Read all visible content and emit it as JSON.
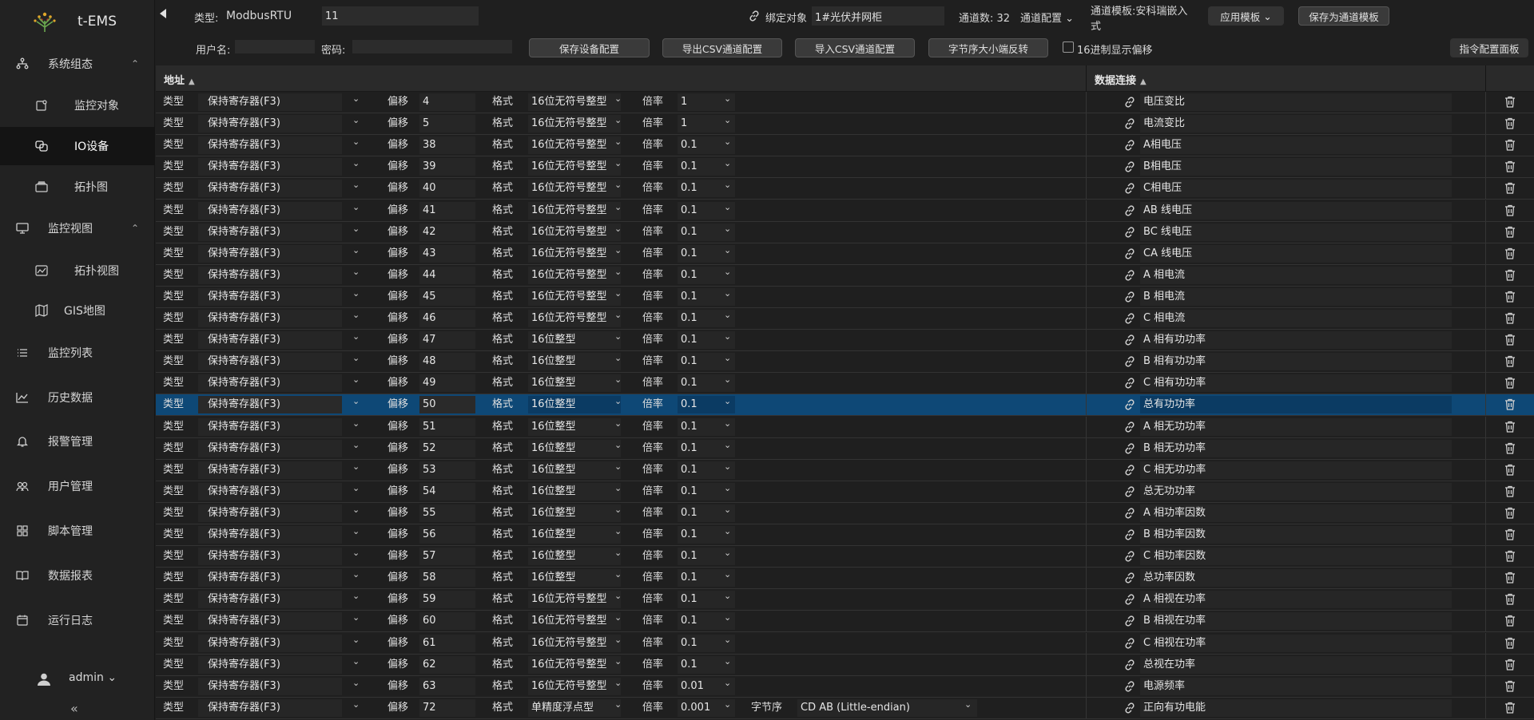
{
  "app": {
    "name": "t-EMS",
    "user": "admin"
  },
  "sidebar": {
    "items": [
      {
        "label": "系统组态",
        "icon": "sitemap-icon",
        "expanded": true
      },
      {
        "label": "监控对象",
        "icon": "monitor-object-icon"
      },
      {
        "label": "IO设备",
        "icon": "io-device-icon",
        "active": true
      },
      {
        "label": "拓扑图",
        "icon": "topology-icon"
      },
      {
        "label": "监控视图",
        "icon": "desktop-icon",
        "expanded": true
      },
      {
        "label": "拓扑视图",
        "icon": "topology-view-icon"
      },
      {
        "label": "GIS地图",
        "icon": "map-icon"
      },
      {
        "label": "监控列表",
        "icon": "list-icon"
      },
      {
        "label": "历史数据",
        "icon": "line-chart-icon"
      },
      {
        "label": "报警管理",
        "icon": "bell-icon"
      },
      {
        "label": "用户管理",
        "icon": "users-icon"
      },
      {
        "label": "脚本管理",
        "icon": "grid-icon"
      },
      {
        "label": "数据报表",
        "icon": "book-icon"
      },
      {
        "label": "运行日志",
        "icon": "calendar-icon"
      }
    ]
  },
  "toolbar": {
    "type_label": "类型:",
    "type_value": "ModbusRTU",
    "device_id": "11",
    "bind_label": "绑定对象",
    "bind_value": "1#光伏并网柜",
    "channel_count": "通道数: 32",
    "channel_config": "通道配置",
    "template_label_1": "通道模板:安科瑞嵌入",
    "template_label_2": "式",
    "apply_template": "应用模板",
    "save_as_template": "保存为通道模板",
    "username_label": "用户名:",
    "username_value": "",
    "password_label": "密码:",
    "password_value": "",
    "save_device": "保存设备配置",
    "export_csv": "导出CSV通道配置",
    "import_csv": "导入CSV通道配置",
    "byte_order_swap": "字节序大小端反转",
    "hex_offset": "16进制显示偏移",
    "hex_offset_checked": false,
    "command_panel": "指令配置面板"
  },
  "table": {
    "col_address": "地址",
    "col_data": "数据连接",
    "labels": {
      "type": "类型",
      "offset": "偏移",
      "format": "格式",
      "ratio": "倍率",
      "byte_order": "字节序"
    },
    "rows": [
      {
        "type": "保持寄存器(F3)",
        "offset": "4",
        "format": "16位无符号整型",
        "ratio": "1",
        "link": "电压变比"
      },
      {
        "type": "保持寄存器(F3)",
        "offset": "5",
        "format": "16位无符号整型",
        "ratio": "1",
        "link": "电流变比"
      },
      {
        "type": "保持寄存器(F3)",
        "offset": "38",
        "format": "16位无符号整型",
        "ratio": "0.1",
        "link": "A相电压"
      },
      {
        "type": "保持寄存器(F3)",
        "offset": "39",
        "format": "16位无符号整型",
        "ratio": "0.1",
        "link": "B相电压"
      },
      {
        "type": "保持寄存器(F3)",
        "offset": "40",
        "format": "16位无符号整型",
        "ratio": "0.1",
        "link": "C相电压"
      },
      {
        "type": "保持寄存器(F3)",
        "offset": "41",
        "format": "16位无符号整型",
        "ratio": "0.1",
        "link": "AB 线电压"
      },
      {
        "type": "保持寄存器(F3)",
        "offset": "42",
        "format": "16位无符号整型",
        "ratio": "0.1",
        "link": "BC 线电压"
      },
      {
        "type": "保持寄存器(F3)",
        "offset": "43",
        "format": "16位无符号整型",
        "ratio": "0.1",
        "link": "CA 线电压"
      },
      {
        "type": "保持寄存器(F3)",
        "offset": "44",
        "format": "16位无符号整型",
        "ratio": "0.1",
        "link": "A 相电流"
      },
      {
        "type": "保持寄存器(F3)",
        "offset": "45",
        "format": "16位无符号整型",
        "ratio": "0.1",
        "link": "B 相电流"
      },
      {
        "type": "保持寄存器(F3)",
        "offset": "46",
        "format": "16位无符号整型",
        "ratio": "0.1",
        "link": "C 相电流"
      },
      {
        "type": "保持寄存器(F3)",
        "offset": "47",
        "format": "16位整型",
        "ratio": "0.1",
        "link": "A 相有功功率"
      },
      {
        "type": "保持寄存器(F3)",
        "offset": "48",
        "format": "16位整型",
        "ratio": "0.1",
        "link": "B 相有功功率"
      },
      {
        "type": "保持寄存器(F3)",
        "offset": "49",
        "format": "16位整型",
        "ratio": "0.1",
        "link": "C 相有功功率"
      },
      {
        "type": "保持寄存器(F3)",
        "offset": "50",
        "format": "16位整型",
        "ratio": "0.1",
        "link": "总有功功率",
        "selected": true
      },
      {
        "type": "保持寄存器(F3)",
        "offset": "51",
        "format": "16位整型",
        "ratio": "0.1",
        "link": "A 相无功功率"
      },
      {
        "type": "保持寄存器(F3)",
        "offset": "52",
        "format": "16位整型",
        "ratio": "0.1",
        "link": "B 相无功功率"
      },
      {
        "type": "保持寄存器(F3)",
        "offset": "53",
        "format": "16位整型",
        "ratio": "0.1",
        "link": "C 相无功功率"
      },
      {
        "type": "保持寄存器(F3)",
        "offset": "54",
        "format": "16位整型",
        "ratio": "0.1",
        "link": "总无功功率"
      },
      {
        "type": "保持寄存器(F3)",
        "offset": "55",
        "format": "16位整型",
        "ratio": "0.1",
        "link": "A 相功率因数"
      },
      {
        "type": "保持寄存器(F3)",
        "offset": "56",
        "format": "16位整型",
        "ratio": "0.1",
        "link": "B 相功率因数"
      },
      {
        "type": "保持寄存器(F3)",
        "offset": "57",
        "format": "16位整型",
        "ratio": "0.1",
        "link": "C 相功率因数"
      },
      {
        "type": "保持寄存器(F3)",
        "offset": "58",
        "format": "16位整型",
        "ratio": "0.1",
        "link": "总功率因数"
      },
      {
        "type": "保持寄存器(F3)",
        "offset": "59",
        "format": "16位无符号整型",
        "ratio": "0.1",
        "link": "A 相视在功率"
      },
      {
        "type": "保持寄存器(F3)",
        "offset": "60",
        "format": "16位无符号整型",
        "ratio": "0.1",
        "link": "B 相视在功率"
      },
      {
        "type": "保持寄存器(F3)",
        "offset": "61",
        "format": "16位无符号整型",
        "ratio": "0.1",
        "link": "C 相视在功率"
      },
      {
        "type": "保持寄存器(F3)",
        "offset": "62",
        "format": "16位无符号整型",
        "ratio": "0.1",
        "link": "总视在功率"
      },
      {
        "type": "保持寄存器(F3)",
        "offset": "63",
        "format": "16位无符号整型",
        "ratio": "0.01",
        "link": "电源频率"
      },
      {
        "type": "保持寄存器(F3)",
        "offset": "72",
        "format": "单精度浮点型",
        "ratio": "0.001",
        "byte_order": "CD AB (Little-endian)",
        "link": "正向有功电能"
      }
    ]
  },
  "colors": {
    "accent_selected_row": "#0e4876",
    "background": "#1f1f1f",
    "sidebar": "#222222"
  }
}
